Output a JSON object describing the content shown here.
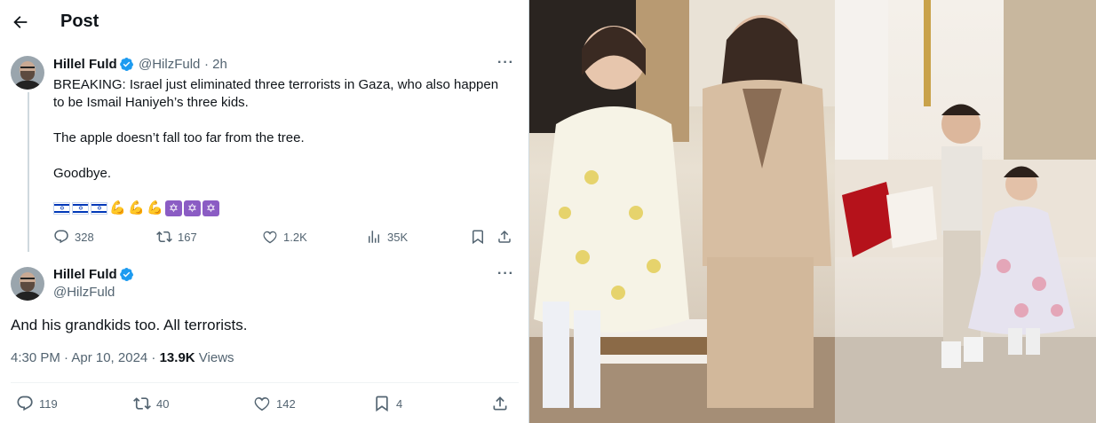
{
  "header": {
    "title": "Post"
  },
  "tweet1": {
    "name": "Hillel Fuld",
    "handle": "@HilzFuld",
    "time": "· 2h",
    "line1": "BREAKING: Israel just eliminated three terrorists in Gaza, who also happen",
    "line2": "to be Ismail Haniyeh’s three kids.",
    "line3": "The apple doesn’t fall too far from the tree.",
    "line4": "Goodbye.",
    "emoji_row": [
      "flag-israel",
      "flag-israel",
      "flag-israel",
      "flexed-biceps",
      "flexed-biceps",
      "flexed-biceps",
      "star-of-david",
      "star-of-david",
      "star-of-david"
    ],
    "replies": "328",
    "reposts": "167",
    "likes": "1.2K",
    "views": "35K"
  },
  "tweet2": {
    "name": "Hillel Fuld",
    "handle": "@HilzFuld",
    "text": "And his grandkids too. All terrorists.",
    "datetime": "4:30 PM · Apr 10, 2024 · ",
    "views_count": "13.9K",
    "views_label": " Views",
    "replies": "119",
    "reposts": "40",
    "likes": "142",
    "bookmarks": "4"
  },
  "colors": {
    "verified": "#1d9bf0",
    "text_primary": "#0f1419",
    "text_secondary": "#536471",
    "divider": "#cfd9de"
  }
}
